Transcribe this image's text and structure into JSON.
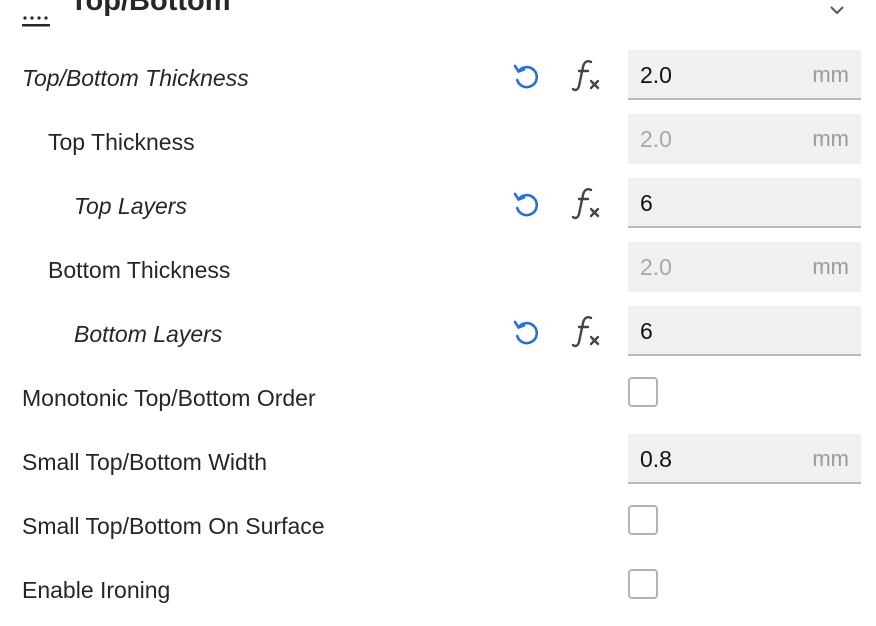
{
  "section": {
    "title": "Top/Bottom"
  },
  "rows": [
    {
      "label": "Top/Bottom Thickness",
      "value": "2.0",
      "unit": "mm"
    },
    {
      "label": "Top Thickness",
      "value": "2.0",
      "unit": "mm"
    },
    {
      "label": "Top Layers",
      "value": "6"
    },
    {
      "label": "Bottom Thickness",
      "value": "2.0",
      "unit": "mm"
    },
    {
      "label": "Bottom Layers",
      "value": "6"
    },
    {
      "label": "Monotonic Top/Bottom Order"
    },
    {
      "label": "Small Top/Bottom Width",
      "value": "0.8",
      "unit": "mm"
    },
    {
      "label": "Small Top/Bottom On Surface"
    },
    {
      "label": "Enable Ironing"
    }
  ],
  "colors": {
    "accent": "#2a70d4",
    "text": "#262626",
    "field_bg": "#f0f0f0",
    "disabled_text": "#a8a8a8"
  },
  "icons": {
    "reset": "reset-icon",
    "formula": "formula-icon",
    "section": "section-icon",
    "chevron": "chevron-down-icon"
  }
}
